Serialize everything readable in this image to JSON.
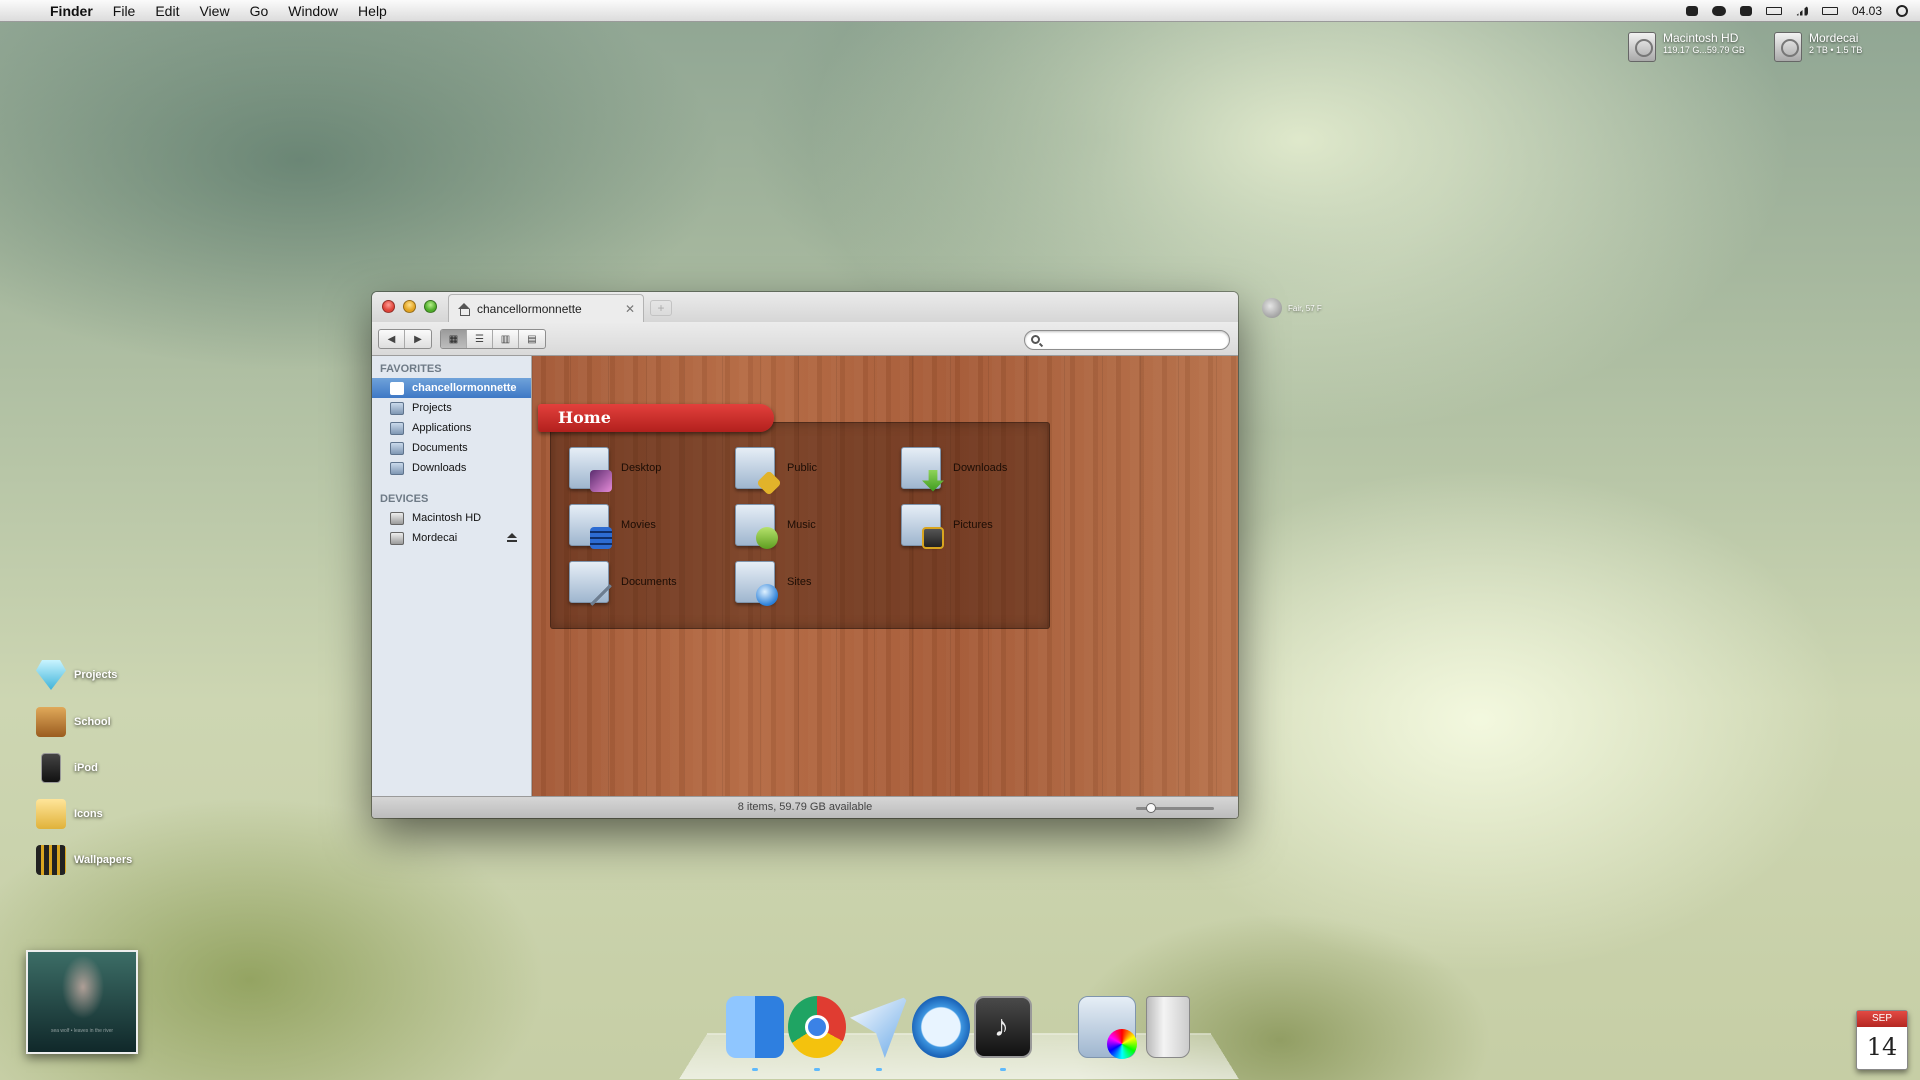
{
  "menubar": {
    "apple": "",
    "items": [
      "Finder",
      "File",
      "Edit",
      "View",
      "Go",
      "Window",
      "Help"
    ],
    "status_icons": [
      "dropbox-icon",
      "cloud-icon",
      "bubble-icon",
      "battery-icon",
      "signal-icon",
      "volume-icon"
    ],
    "clock": "04.03"
  },
  "drives": [
    {
      "name": "Macintosh HD",
      "info": "119.17 G...59.79 GB"
    },
    {
      "name": "Mordecai",
      "info": "2 TB • 1.5 TB"
    }
  ],
  "weather": {
    "text": "Fair, 57 F"
  },
  "window": {
    "tab_title": "chancellormonnette",
    "new_tab": "+",
    "favorites_header": "FAVORITES",
    "favorites": [
      "chancellormonnette",
      "Projects",
      "Applications",
      "Documents",
      "Downloads"
    ],
    "devices_header": "DEVICES",
    "devices": [
      "Macintosh HD",
      "Mordecai"
    ],
    "banner": "Home",
    "items": [
      "Desktop",
      "Public",
      "Downloads",
      "Movies",
      "Music",
      "Pictures",
      "Documents",
      "Sites"
    ],
    "status": "8 items, 59.79 GB available",
    "icon_size_fraction": 0.15
  },
  "desktop_icons": [
    "Projects",
    "School",
    "iPod",
    "Icons",
    "Wallpapers"
  ],
  "album": {
    "caption": "sea wolf • leaves in the river"
  },
  "dock": [
    "Finder",
    "Google Chrome",
    "Sparrow",
    "Time Machine",
    "iTunes",
    "Applications",
    "Trash"
  ],
  "calendar": {
    "month": "SEP",
    "day": "14"
  },
  "colors": {
    "accent": "#3e78c5",
    "ribbon": "#c42b27",
    "wood": "#ab6039"
  }
}
